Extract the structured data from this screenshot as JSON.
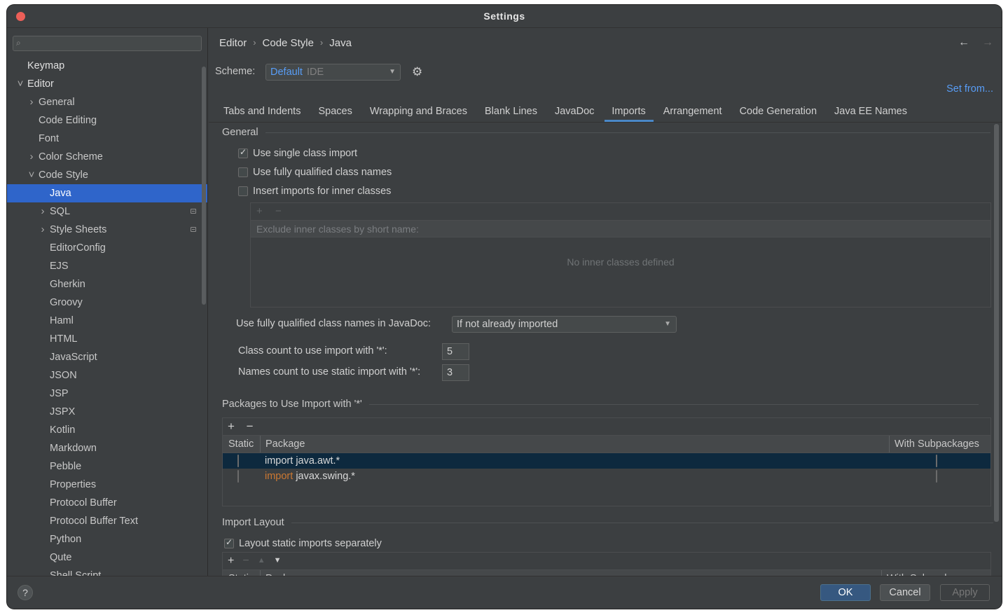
{
  "window": {
    "title": "Settings"
  },
  "sidebar": {
    "search_placeholder": "",
    "items": [
      {
        "label": "Keymap",
        "level": 0,
        "expandable": false,
        "expanded": false,
        "selected": false,
        "badge": false,
        "bold": true
      },
      {
        "label": "Editor",
        "level": 0,
        "expandable": true,
        "expanded": true,
        "selected": false,
        "badge": false,
        "bold": true
      },
      {
        "label": "General",
        "level": 1,
        "expandable": true,
        "expanded": false,
        "selected": false,
        "badge": false
      },
      {
        "label": "Code Editing",
        "level": 1,
        "expandable": false,
        "expanded": false,
        "selected": false,
        "badge": false
      },
      {
        "label": "Font",
        "level": 1,
        "expandable": false,
        "expanded": false,
        "selected": false,
        "badge": false
      },
      {
        "label": "Color Scheme",
        "level": 1,
        "expandable": true,
        "expanded": false,
        "selected": false,
        "badge": false
      },
      {
        "label": "Code Style",
        "level": 1,
        "expandable": true,
        "expanded": true,
        "selected": false,
        "badge": false
      },
      {
        "label": "Java",
        "level": 2,
        "expandable": false,
        "expanded": false,
        "selected": true,
        "badge": false
      },
      {
        "label": "SQL",
        "level": 2,
        "expandable": true,
        "expanded": false,
        "selected": false,
        "badge": true
      },
      {
        "label": "Style Sheets",
        "level": 2,
        "expandable": true,
        "expanded": false,
        "selected": false,
        "badge": true
      },
      {
        "label": "EditorConfig",
        "level": 2,
        "expandable": false,
        "expanded": false,
        "selected": false,
        "badge": false
      },
      {
        "label": "EJS",
        "level": 2,
        "expandable": false,
        "expanded": false,
        "selected": false,
        "badge": false
      },
      {
        "label": "Gherkin",
        "level": 2,
        "expandable": false,
        "expanded": false,
        "selected": false,
        "badge": false
      },
      {
        "label": "Groovy",
        "level": 2,
        "expandable": false,
        "expanded": false,
        "selected": false,
        "badge": false
      },
      {
        "label": "Haml",
        "level": 2,
        "expandable": false,
        "expanded": false,
        "selected": false,
        "badge": false
      },
      {
        "label": "HTML",
        "level": 2,
        "expandable": false,
        "expanded": false,
        "selected": false,
        "badge": false
      },
      {
        "label": "JavaScript",
        "level": 2,
        "expandable": false,
        "expanded": false,
        "selected": false,
        "badge": false
      },
      {
        "label": "JSON",
        "level": 2,
        "expandable": false,
        "expanded": false,
        "selected": false,
        "badge": false
      },
      {
        "label": "JSP",
        "level": 2,
        "expandable": false,
        "expanded": false,
        "selected": false,
        "badge": false
      },
      {
        "label": "JSPX",
        "level": 2,
        "expandable": false,
        "expanded": false,
        "selected": false,
        "badge": false
      },
      {
        "label": "Kotlin",
        "level": 2,
        "expandable": false,
        "expanded": false,
        "selected": false,
        "badge": false
      },
      {
        "label": "Markdown",
        "level": 2,
        "expandable": false,
        "expanded": false,
        "selected": false,
        "badge": false
      },
      {
        "label": "Pebble",
        "level": 2,
        "expandable": false,
        "expanded": false,
        "selected": false,
        "badge": false
      },
      {
        "label": "Properties",
        "level": 2,
        "expandable": false,
        "expanded": false,
        "selected": false,
        "badge": false
      },
      {
        "label": "Protocol Buffer",
        "level": 2,
        "expandable": false,
        "expanded": false,
        "selected": false,
        "badge": false
      },
      {
        "label": "Protocol Buffer Text",
        "level": 2,
        "expandable": false,
        "expanded": false,
        "selected": false,
        "badge": false
      },
      {
        "label": "Python",
        "level": 2,
        "expandable": false,
        "expanded": false,
        "selected": false,
        "badge": false
      },
      {
        "label": "Qute",
        "level": 2,
        "expandable": false,
        "expanded": false,
        "selected": false,
        "badge": false
      },
      {
        "label": "Shell Script",
        "level": 2,
        "expandable": false,
        "expanded": false,
        "selected": false,
        "badge": false
      }
    ]
  },
  "breadcrumb": [
    "Editor",
    "Code Style",
    "Java"
  ],
  "nav": {
    "back_icon": "arrow-left-icon",
    "forward_icon": "arrow-right-icon"
  },
  "scheme": {
    "label": "Scheme:",
    "name": "Default",
    "suffix": "IDE",
    "gear_icon": "gear-icon"
  },
  "set_from": "Set from...",
  "tabs": [
    {
      "label": "Tabs and Indents",
      "active": false
    },
    {
      "label": "Spaces",
      "active": false
    },
    {
      "label": "Wrapping and Braces",
      "active": false
    },
    {
      "label": "Blank Lines",
      "active": false
    },
    {
      "label": "JavaDoc",
      "active": false
    },
    {
      "label": "Imports",
      "active": true
    },
    {
      "label": "Arrangement",
      "active": false
    },
    {
      "label": "Code Generation",
      "active": false
    },
    {
      "label": "Java EE Names",
      "active": false
    }
  ],
  "general": {
    "title": "General",
    "options": [
      {
        "label": "Use single class import",
        "checked": true
      },
      {
        "label": "Use fully qualified class names",
        "checked": false
      },
      {
        "label": "Insert imports for inner classes",
        "checked": false
      }
    ],
    "inner_classes": {
      "add": "+",
      "remove": "−",
      "header": "Exclude inner classes by short name:",
      "empty_text": "No inner classes defined"
    },
    "javadoc_label": "Use fully qualified class names in JavaDoc:",
    "javadoc_value": "If not already imported",
    "class_count_label": "Class count to use import with '*':",
    "class_count_value": "5",
    "names_count_label": "Names count to use static import with '*':",
    "names_count_value": "3"
  },
  "packages": {
    "title": "Packages to Use Import with '*'",
    "add": "+",
    "remove": "−",
    "columns": {
      "static": "Static",
      "package": "Package",
      "subpackages": "With Subpackages"
    },
    "rows": [
      {
        "static": false,
        "keyword": "import",
        "package": "java.awt.*",
        "subpackages": false,
        "selected": true,
        "keyword_highlight": false
      },
      {
        "static": false,
        "keyword": "import",
        "package": "javax.swing.*",
        "subpackages": false,
        "selected": false,
        "keyword_highlight": true
      }
    ]
  },
  "import_layout": {
    "title": "Import Layout",
    "option_label": "Layout static imports separately",
    "option_checked": true,
    "toolbar": {
      "add": "+",
      "remove": "−",
      "up": "▲",
      "down": "▼"
    },
    "columns": {
      "static": "Static",
      "package": "Package",
      "subpackages": "With Subpackages"
    }
  },
  "footer": {
    "help": "?",
    "ok": "OK",
    "cancel": "Cancel",
    "apply": "Apply"
  },
  "colors": {
    "accent": "#2f65ca",
    "link": "#589df6",
    "keyword": "#cc7832",
    "selected_row": "#0d293e"
  }
}
